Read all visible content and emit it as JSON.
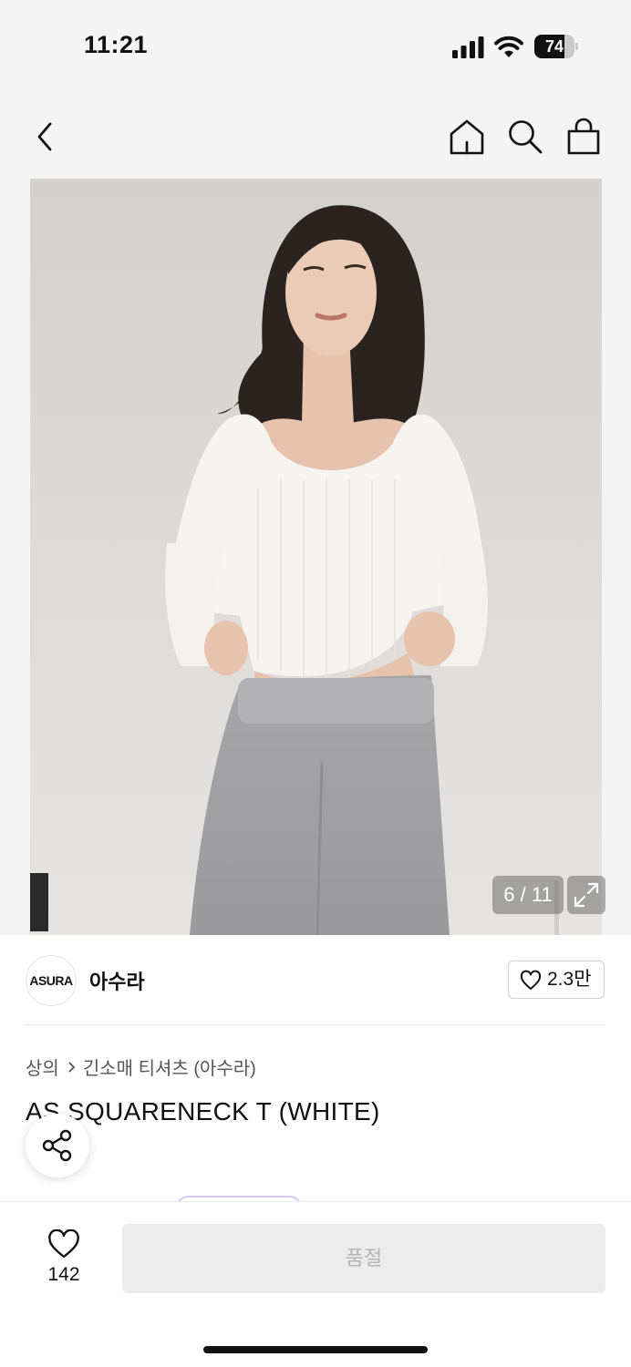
{
  "status_bar": {
    "time": "11:21",
    "battery": "74",
    "battery_level": 0.74
  },
  "header": {
    "back_icon": "chevron-left-icon",
    "home_icon": "home-icon",
    "search_icon": "search-icon",
    "cart_icon": "shopping-bag-icon"
  },
  "gallery": {
    "current": 6,
    "total": 11,
    "indicator": "6 / 11",
    "expand_icon": "expand-icon"
  },
  "brand": {
    "logo_text": "ASURA",
    "name": "아수라",
    "like_count": "2.3만",
    "like_icon": "heart-icon"
  },
  "product": {
    "breadcrumb": [
      "상의",
      "긴소매 티셔츠 (아수라)"
    ],
    "title": "AS SQUARENECK T (WHITE)",
    "share_icon": "share-icon"
  },
  "bottom_bar": {
    "wish_count": "142",
    "buy_label": "품절"
  }
}
